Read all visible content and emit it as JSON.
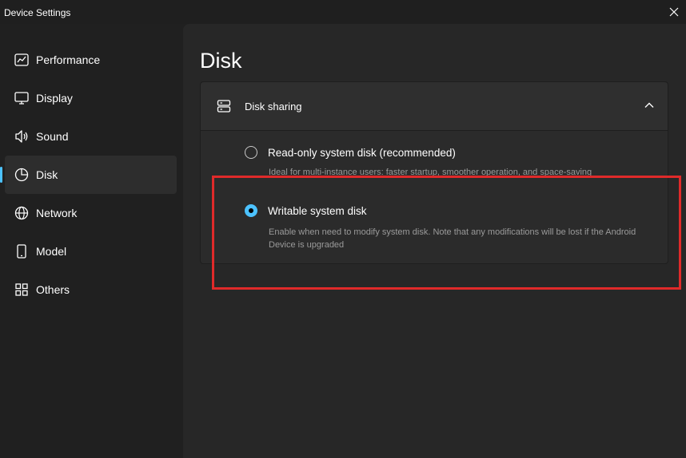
{
  "window": {
    "title": "Device Settings",
    "close_icon": "close-icon"
  },
  "sidebar": {
    "items": [
      {
        "label": "Performance",
        "icon": "performance-chart-icon",
        "active": false
      },
      {
        "label": "Display",
        "icon": "monitor-icon",
        "active": false
      },
      {
        "label": "Sound",
        "icon": "speaker-icon",
        "active": false
      },
      {
        "label": "Disk",
        "icon": "disk-pie-icon",
        "active": true
      },
      {
        "label": "Network",
        "icon": "globe-icon",
        "active": false
      },
      {
        "label": "Model",
        "icon": "phone-icon",
        "active": false
      },
      {
        "label": "Others",
        "icon": "grid-icon",
        "active": false
      }
    ]
  },
  "main": {
    "title": "Disk",
    "card": {
      "title": "Disk sharing",
      "icon": "server-icon",
      "expanded": true,
      "options": [
        {
          "label": "Read-only system disk (recommended)",
          "description": "Ideal for multi-instance users: faster startup, smoother operation, and space-saving",
          "checked": false
        },
        {
          "label": "Writable system disk",
          "description": "Enable when need to modify system disk. Note that any modifications will be lost if the Android Device is upgraded",
          "checked": true
        }
      ]
    }
  },
  "colors": {
    "accent": "#4cc2ff",
    "highlight": "#e02a2a",
    "background": "#202020",
    "panel": "#272727"
  }
}
